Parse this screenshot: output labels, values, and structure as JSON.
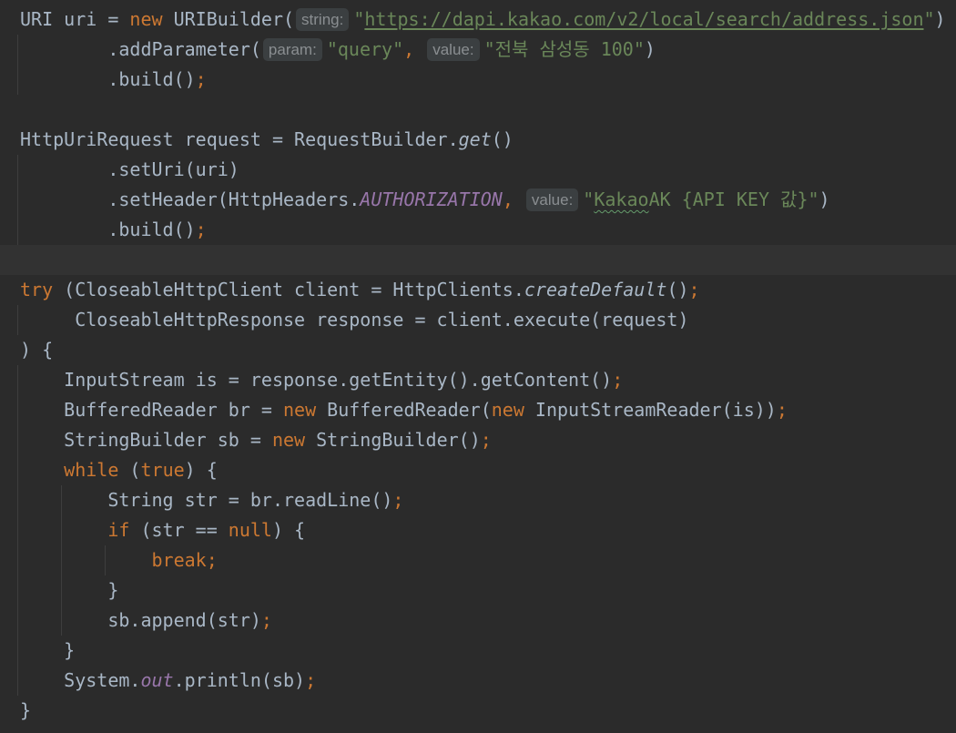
{
  "editor": {
    "theme": {
      "background": "#2B2B2B",
      "current_line": "#323232",
      "text": "#A9B7C6",
      "keyword": "#CC7832",
      "string": "#6A8759",
      "static_field": "#9876AA",
      "hint_text": "#8A8E91",
      "hint_background": "#3B3F41",
      "indent_guide": "#3E3E3E",
      "typo_underline": "#659C6B"
    },
    "lines": [
      {
        "tokens": [
          {
            "p": "URI uri = "
          },
          {
            "k": "new"
          },
          {
            "p": " URIBuilder("
          },
          {
            "h": "string:"
          },
          {
            "s": "\""
          },
          {
            "u": "https://dapi.kakao.com/v2/local/search/address.json"
          },
          {
            "s": "\""
          },
          {
            "p": ")"
          }
        ]
      },
      {
        "tokens": [
          {
            "p": "        .addParameter("
          },
          {
            "h": "param:"
          },
          {
            "s": "\"query\""
          },
          {
            "o": ","
          },
          {
            "p": " "
          },
          {
            "h": "value:"
          },
          {
            "s": "\"전북 삼성동 100\""
          },
          {
            "p": ")"
          }
        ]
      },
      {
        "tokens": [
          {
            "p": "        .build()"
          },
          {
            "o": ";"
          }
        ]
      },
      {
        "tokens": []
      },
      {
        "tokens": [
          {
            "p": "HttpUriRequest request = RequestBuilder."
          },
          {
            "m": "get"
          },
          {
            "p": "()"
          }
        ]
      },
      {
        "tokens": [
          {
            "p": "        .setUri(uri)"
          }
        ]
      },
      {
        "tokens": [
          {
            "p": "        .setHeader(HttpHeaders."
          },
          {
            "f": "AUTHORIZATION"
          },
          {
            "o": ","
          },
          {
            "p": " "
          },
          {
            "h": "value:"
          },
          {
            "s": "\""
          },
          {
            "t": "Kakao"
          },
          {
            "s": "AK {API KEY 값}\""
          },
          {
            "p": ")"
          }
        ]
      },
      {
        "tokens": [
          {
            "p": "        .build()"
          },
          {
            "o": ";"
          }
        ]
      },
      {
        "current": true,
        "tokens": []
      },
      {
        "tokens": [
          {
            "k": "try"
          },
          {
            "p": " (CloseableHttpClient client = HttpClients."
          },
          {
            "m": "createDefault"
          },
          {
            "p": "()"
          },
          {
            "o": ";"
          }
        ]
      },
      {
        "tokens": [
          {
            "p": "     CloseableHttpResponse response = client.execute(request)"
          }
        ]
      },
      {
        "tokens": [
          {
            "p": ") {"
          }
        ]
      },
      {
        "tokens": [
          {
            "p": "    InputStream is = response.getEntity().getContent()"
          },
          {
            "o": ";"
          }
        ]
      },
      {
        "tokens": [
          {
            "p": "    BufferedReader br = "
          },
          {
            "k": "new"
          },
          {
            "p": " BufferedReader("
          },
          {
            "k": "new"
          },
          {
            "p": " InputStreamReader(is))"
          },
          {
            "o": ";"
          }
        ]
      },
      {
        "tokens": [
          {
            "p": "    StringBuilder sb = "
          },
          {
            "k": "new"
          },
          {
            "p": " StringBuilder()"
          },
          {
            "o": ";"
          }
        ]
      },
      {
        "tokens": [
          {
            "p": "    "
          },
          {
            "k": "while"
          },
          {
            "p": " ("
          },
          {
            "k": "true"
          },
          {
            "p": ") {"
          }
        ]
      },
      {
        "tokens": [
          {
            "p": "        String str = br.readLine()"
          },
          {
            "o": ";"
          }
        ]
      },
      {
        "tokens": [
          {
            "p": "        "
          },
          {
            "k": "if"
          },
          {
            "p": " (str == "
          },
          {
            "k": "null"
          },
          {
            "p": ") {"
          }
        ]
      },
      {
        "tokens": [
          {
            "p": "            "
          },
          {
            "k": "break"
          },
          {
            "o": ";"
          }
        ]
      },
      {
        "tokens": [
          {
            "p": "        }"
          }
        ]
      },
      {
        "tokens": [
          {
            "p": "        sb.append(str)"
          },
          {
            "o": ";"
          }
        ]
      },
      {
        "tokens": [
          {
            "p": "    }"
          }
        ]
      },
      {
        "tokens": [
          {
            "p": "    System."
          },
          {
            "f": "out"
          },
          {
            "p": ".println(sb)"
          },
          {
            "o": ";"
          }
        ]
      },
      {
        "tokens": [
          {
            "p": "}"
          }
        ]
      }
    ]
  }
}
